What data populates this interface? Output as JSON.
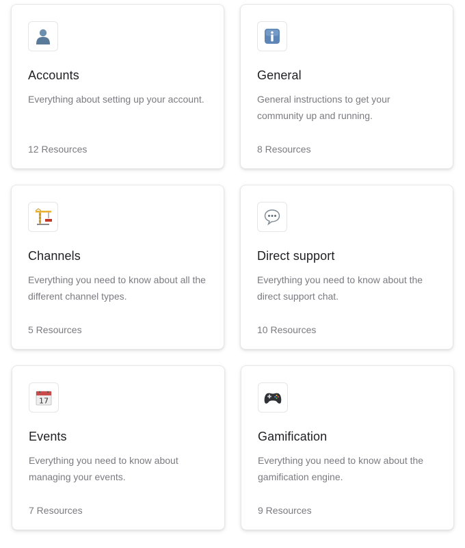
{
  "categories": [
    {
      "icon": "user-icon",
      "title": "Accounts",
      "description": "Everything about setting up your account.",
      "resources": "12 Resources"
    },
    {
      "icon": "info-icon",
      "title": "General",
      "description": "General instructions to get your community up and running.",
      "resources": "8 Resources"
    },
    {
      "icon": "crane-icon",
      "title": "Channels",
      "description": "Everything you need to know about all the different channel types.",
      "resources": "5 Resources"
    },
    {
      "icon": "speech-bubble-icon",
      "title": "Direct support",
      "description": "Everything you need to know about the direct support chat.",
      "resources": "10 Resources"
    },
    {
      "icon": "calendar-icon",
      "title": "Events",
      "description": "Everything you need to know about managing your events.",
      "resources": "7 Resources"
    },
    {
      "icon": "game-controller-icon",
      "title": "Gamification",
      "description": "Everything you need to know about the gamification engine.",
      "resources": "9 Resources"
    }
  ],
  "colors": {
    "title": "#1f1f23",
    "muted_text": "#7a7a80",
    "card_border": "#e7e7ea"
  },
  "calendar_day": "17"
}
